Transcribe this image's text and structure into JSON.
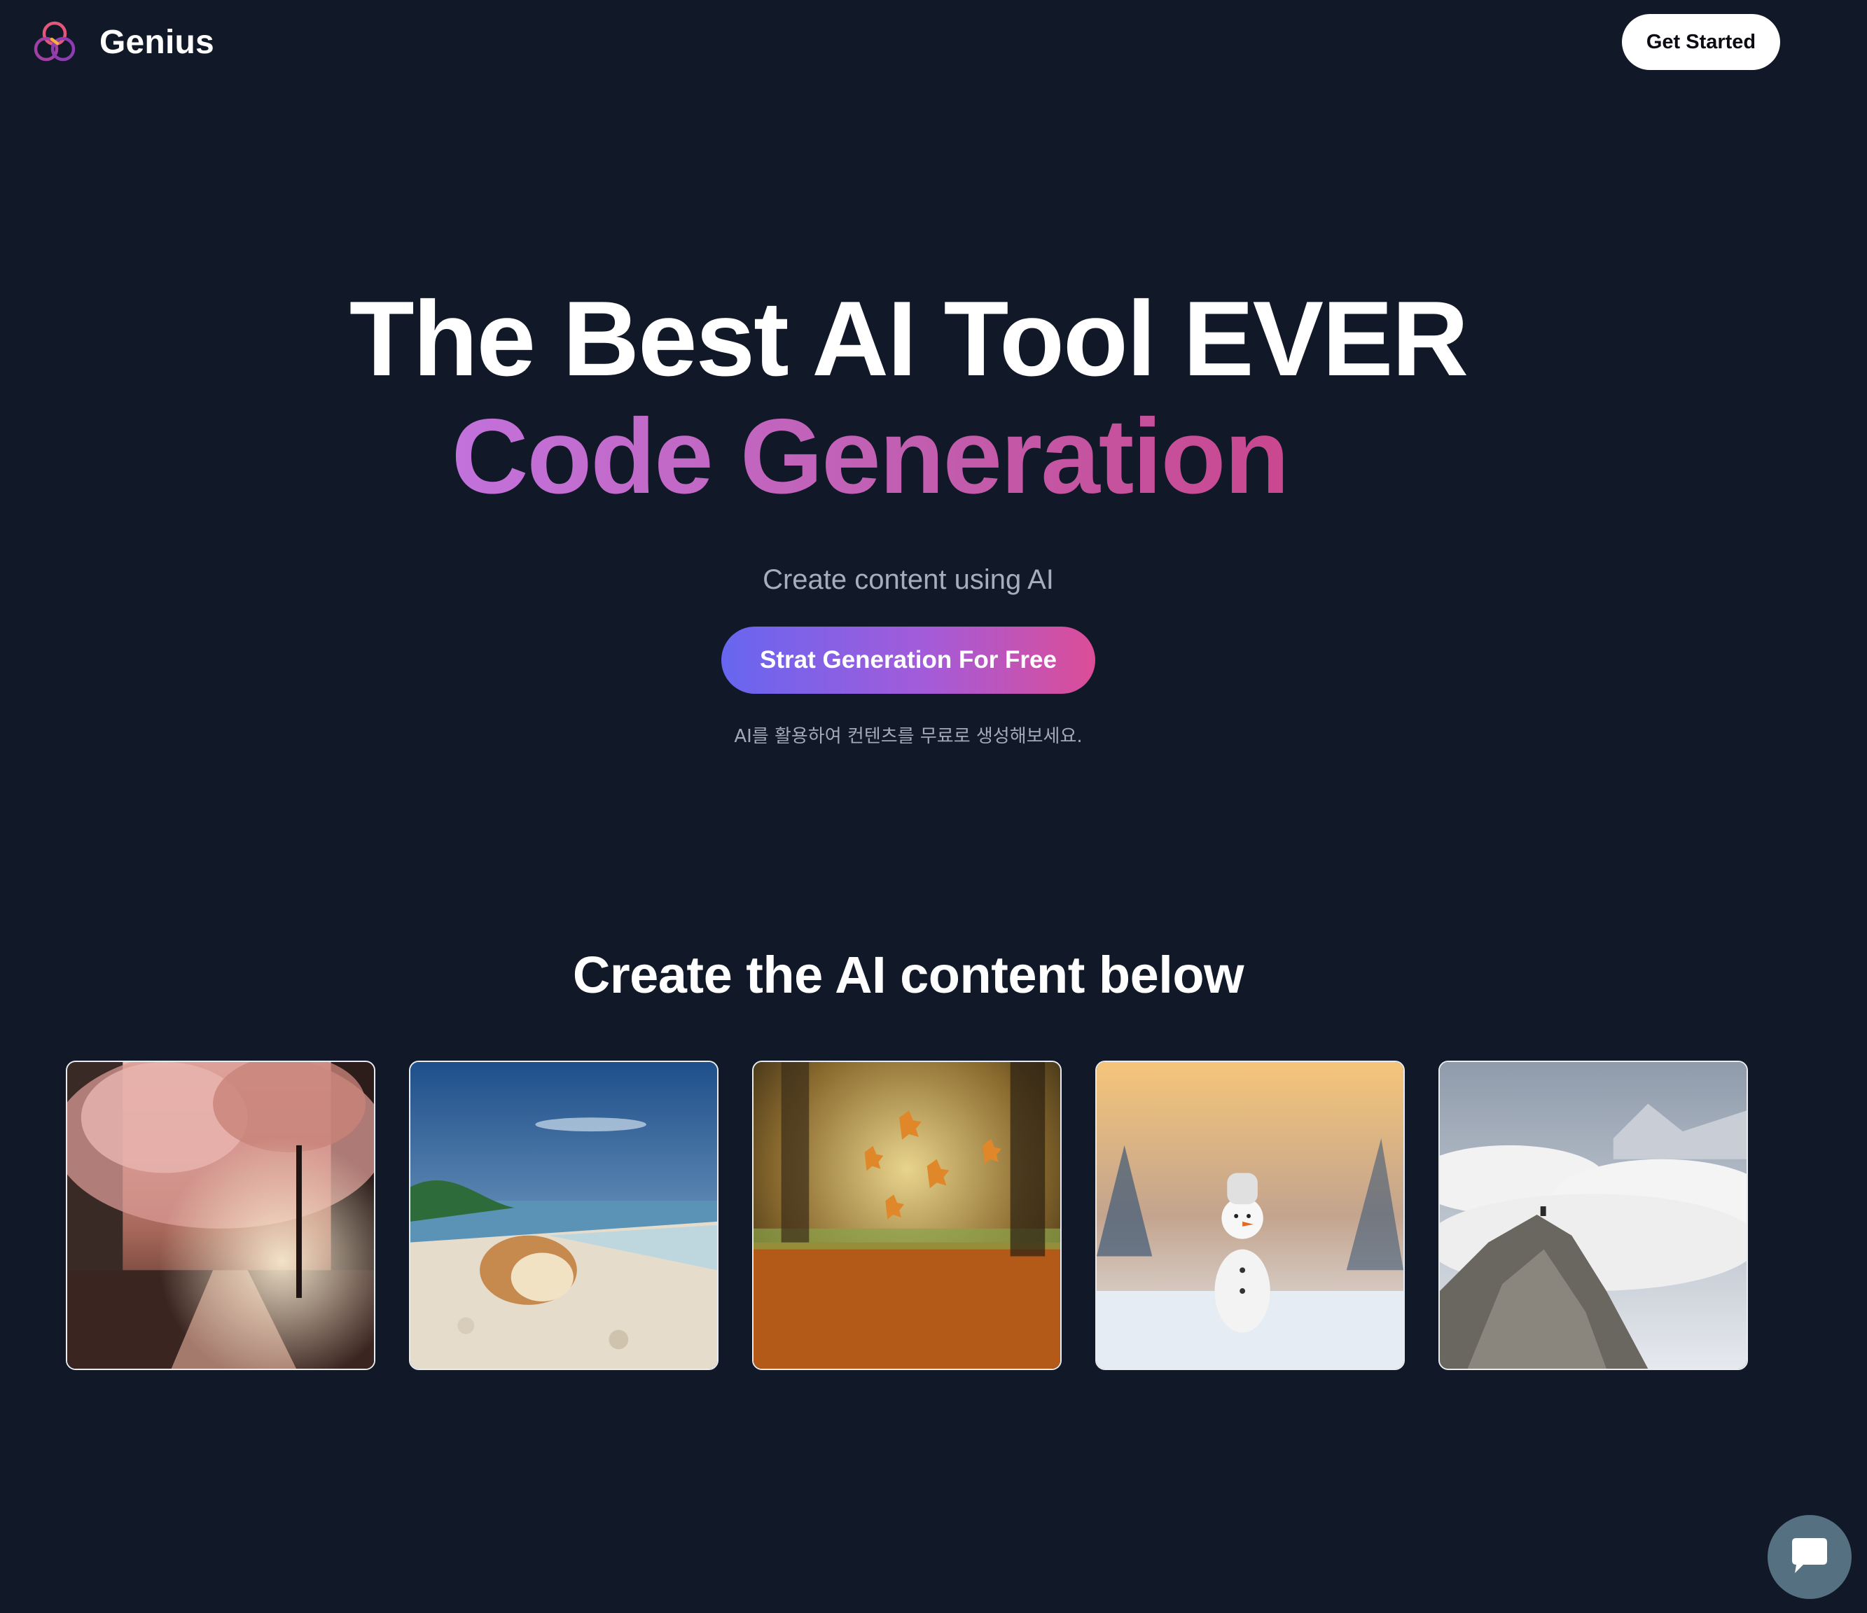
{
  "header": {
    "brand_name": "Genius",
    "logo_icon": "genius-trefoil-logo",
    "cta_label": "Get Started"
  },
  "hero": {
    "title": "The Best AI Tool EVER",
    "rotating_word": "Code Generation",
    "description": "Create content using AI",
    "cta_label": "Strat Generation For Free",
    "note": "AI를 활용하여 컨텐츠를 무료로 생성해보세요."
  },
  "gallery": {
    "title": "Create the AI content below",
    "items": [
      {
        "subject": "cherry-blossom-street"
      },
      {
        "subject": "seashell-beach"
      },
      {
        "subject": "autumn-falling-leaves"
      },
      {
        "subject": "snowman-winter"
      },
      {
        "subject": "mountain-peak-above-clouds"
      }
    ]
  },
  "chat": {
    "icon": "chat-bubble-icon"
  },
  "colors": {
    "background": "#111827",
    "gradient_start": "#6766f0",
    "gradient_end": "#dc4d97",
    "headline_accent": "#c25eb0"
  }
}
